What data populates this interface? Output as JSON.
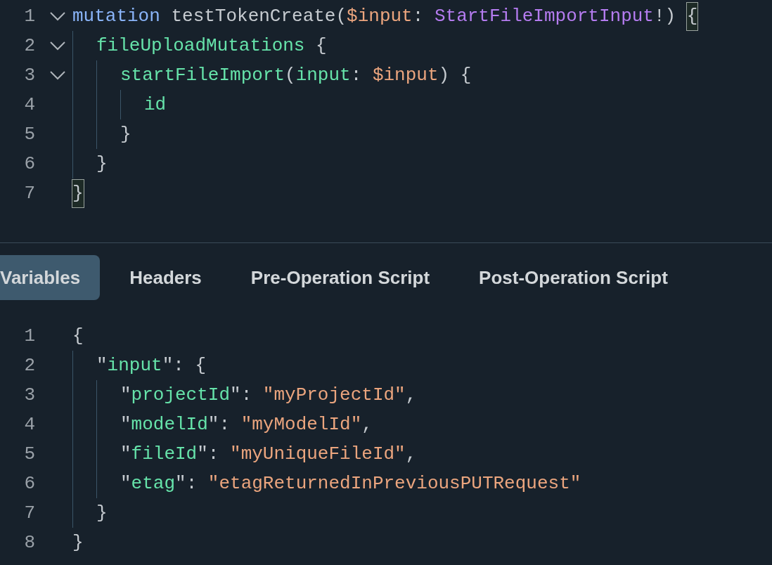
{
  "query_editor": {
    "lines": [
      {
        "number": "1",
        "fold": true,
        "tokens": [
          {
            "kind": "keyword",
            "text": "mutation"
          },
          {
            "kind": "plain",
            "text": " testTokenCreate("
          },
          {
            "kind": "variable",
            "text": "$input"
          },
          {
            "kind": "plain",
            "text": ": "
          },
          {
            "kind": "type",
            "text": "StartFileImportInput"
          },
          {
            "kind": "plain",
            "text": "!) "
          },
          {
            "kind": "bracket-match",
            "text": "{"
          }
        ],
        "children": [
          {
            "number": "2",
            "fold": true,
            "tokens": [
              {
                "kind": "field",
                "text": "fileUploadMutations"
              },
              {
                "kind": "plain",
                "text": " {"
              }
            ],
            "children": [
              {
                "number": "3",
                "fold": true,
                "tokens": [
                  {
                    "kind": "field",
                    "text": "startFileImport"
                  },
                  {
                    "kind": "plain",
                    "text": "("
                  },
                  {
                    "kind": "field",
                    "text": "input"
                  },
                  {
                    "kind": "plain",
                    "text": ": "
                  },
                  {
                    "kind": "variable",
                    "text": "$input"
                  },
                  {
                    "kind": "plain",
                    "text": ") {"
                  }
                ],
                "children": [
                  {
                    "number": "4",
                    "fold": false,
                    "tokens": [
                      {
                        "kind": "field",
                        "text": "id"
                      }
                    ]
                  }
                ]
              },
              {
                "number": "5",
                "fold": false,
                "tokens": [
                  {
                    "kind": "plain",
                    "text": "}"
                  }
                ]
              }
            ]
          },
          {
            "number": "6",
            "fold": false,
            "tokens": [
              {
                "kind": "plain",
                "text": "}"
              }
            ]
          }
        ]
      },
      {
        "number": "7",
        "fold": false,
        "tokens": [
          {
            "kind": "bracket-match",
            "text": "}"
          }
        ]
      }
    ]
  },
  "tabs": [
    {
      "label": "Variables",
      "selected": true
    },
    {
      "label": "Headers",
      "selected": false
    },
    {
      "label": "Pre-Operation Script",
      "selected": false
    },
    {
      "label": "Post-Operation Script",
      "selected": false
    }
  ],
  "variables_editor": {
    "lines": [
      {
        "number": "1",
        "fold": false,
        "tokens": [
          {
            "kind": "plain",
            "text": "{"
          }
        ],
        "children": [
          {
            "number": "2",
            "fold": false,
            "tokens": [
              {
                "kind": "plain",
                "text": "\""
              },
              {
                "kind": "field",
                "text": "input"
              },
              {
                "kind": "plain",
                "text": "\": {"
              }
            ],
            "children": [
              {
                "number": "3",
                "fold": false,
                "tokens": [
                  {
                    "kind": "plain",
                    "text": "\""
                  },
                  {
                    "kind": "field",
                    "text": "projectId"
                  },
                  {
                    "kind": "plain",
                    "text": "\": "
                  },
                  {
                    "kind": "string",
                    "text": "\"myProjectId\""
                  },
                  {
                    "kind": "plain",
                    "text": ","
                  }
                ]
              },
              {
                "number": "4",
                "fold": false,
                "tokens": [
                  {
                    "kind": "plain",
                    "text": "\""
                  },
                  {
                    "kind": "field",
                    "text": "modelId"
                  },
                  {
                    "kind": "plain",
                    "text": "\": "
                  },
                  {
                    "kind": "string",
                    "text": "\"myModelId\""
                  },
                  {
                    "kind": "plain",
                    "text": ","
                  }
                ]
              },
              {
                "number": "5",
                "fold": false,
                "tokens": [
                  {
                    "kind": "plain",
                    "text": "\""
                  },
                  {
                    "kind": "field",
                    "text": "fileId"
                  },
                  {
                    "kind": "plain",
                    "text": "\": "
                  },
                  {
                    "kind": "string",
                    "text": "\"myUniqueFileId\""
                  },
                  {
                    "kind": "plain",
                    "text": ","
                  }
                ]
              },
              {
                "number": "6",
                "fold": false,
                "tokens": [
                  {
                    "kind": "plain",
                    "text": "\""
                  },
                  {
                    "kind": "field",
                    "text": "etag"
                  },
                  {
                    "kind": "plain",
                    "text": "\": "
                  },
                  {
                    "kind": "string",
                    "text": "\"etagReturnedInPreviousPUTRequest\""
                  }
                ]
              }
            ]
          },
          {
            "number": "7",
            "fold": false,
            "tokens": [
              {
                "kind": "plain",
                "text": "}"
              }
            ]
          }
        ]
      },
      {
        "number": "8",
        "fold": false,
        "tokens": [
          {
            "kind": "plain",
            "text": "}"
          }
        ]
      }
    ]
  }
}
